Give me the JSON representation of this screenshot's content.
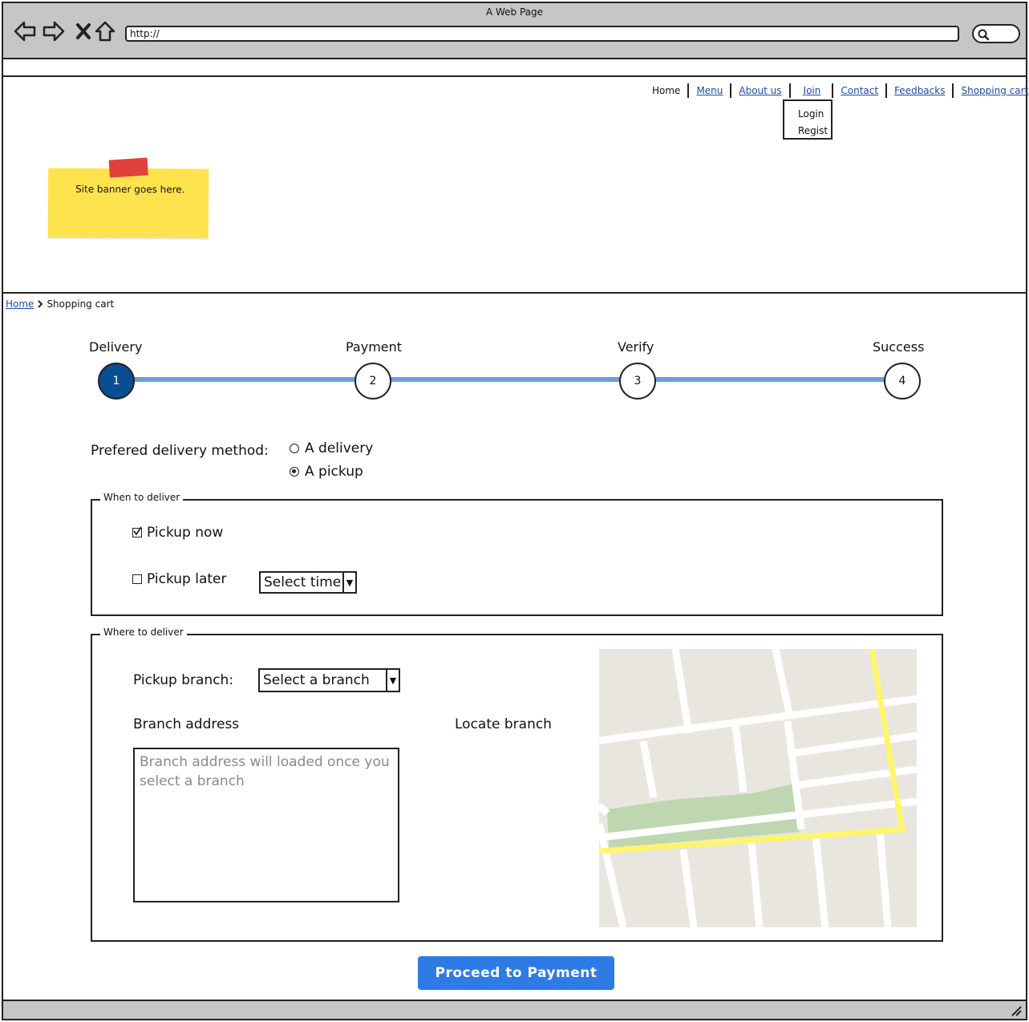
{
  "browser": {
    "window_title": "A Web Page",
    "url": "http://"
  },
  "nav": {
    "items": [
      "Home",
      "Menu",
      "About us",
      "Join",
      "Contact",
      "Feedbacks",
      "Shopping cart"
    ],
    "join_dropdown": [
      "Login",
      "Regist"
    ]
  },
  "banner": {
    "text": "Site banner goes here."
  },
  "breadcrumb": {
    "home": "Home",
    "current": "Shopping cart"
  },
  "stepper": {
    "active_step": 1,
    "steps": [
      {
        "label": "Delivery",
        "number": "1"
      },
      {
        "label": "Payment",
        "number": "2"
      },
      {
        "label": "Verify",
        "number": "3"
      },
      {
        "label": "Success",
        "number": "4"
      }
    ]
  },
  "delivery_method": {
    "label": "Prefered delivery method:",
    "options": [
      {
        "label": "A delivery",
        "selected": false
      },
      {
        "label": "A pickup",
        "selected": true
      }
    ]
  },
  "when": {
    "legend": "When to deliver",
    "pickup_now": {
      "label": "Pickup now",
      "checked": true
    },
    "pickup_later": {
      "label": "Pickup later",
      "checked": false
    },
    "time_select": "Select time"
  },
  "where": {
    "legend": "Where to deliver",
    "branch_label": "Pickup branch:",
    "branch_select": "Select a branch",
    "address_label": "Branch address",
    "address_placeholder": "Branch address will loaded once you select a branch",
    "locate_label": "Locate branch"
  },
  "actions": {
    "proceed": "Proceed to Payment"
  },
  "colors": {
    "accent": "#2f7be5",
    "step_active": "#0b4d91",
    "progress_line": "#6f9fd8",
    "banner": "#ffe34e",
    "link": "#1f4aa8"
  }
}
